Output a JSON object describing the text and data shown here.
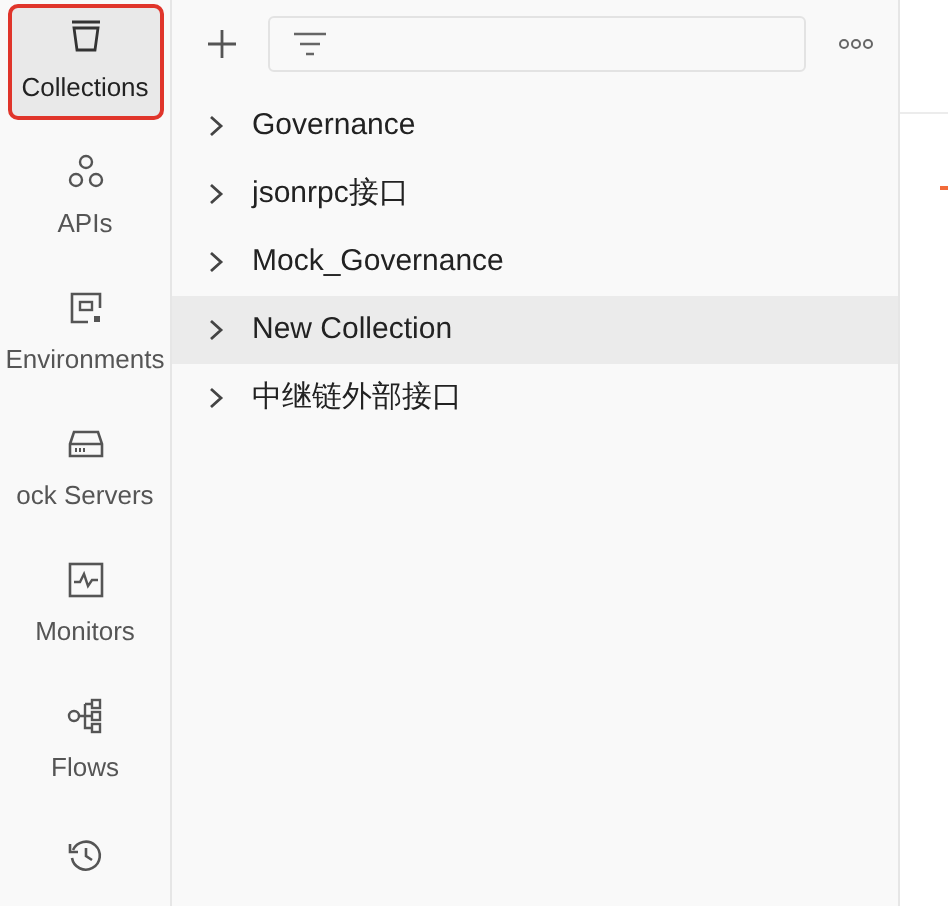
{
  "sidebar": {
    "items": [
      {
        "label": "Collections",
        "selected": true
      },
      {
        "label": "APIs",
        "selected": false
      },
      {
        "label": "Environments",
        "selected": false
      },
      {
        "label": "ock Servers",
        "selected": false
      },
      {
        "label": "Monitors",
        "selected": false
      },
      {
        "label": "Flows",
        "selected": false
      },
      {
        "selected": false
      }
    ]
  },
  "collections": {
    "items": [
      {
        "name": "Governance",
        "selected": false
      },
      {
        "name": "jsonrpc接口",
        "selected": false
      },
      {
        "name": "Mock_Governance",
        "selected": false
      },
      {
        "name": "New Collection",
        "selected": true
      },
      {
        "name": "中继链外部接口",
        "selected": false
      }
    ]
  }
}
